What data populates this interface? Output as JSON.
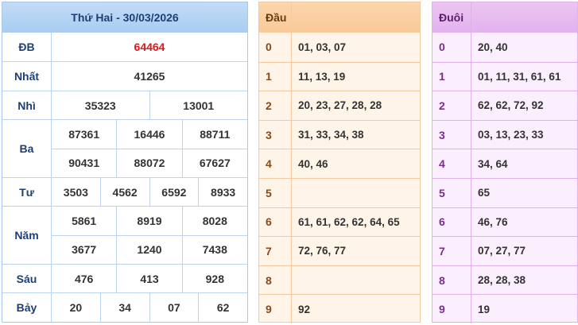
{
  "results": {
    "title": "Thứ Hai - 30/03/2026",
    "prizes": [
      {
        "name": "ĐB",
        "lines": [
          [
            "64464"
          ]
        ]
      },
      {
        "name": "Nhất",
        "lines": [
          [
            "41265"
          ]
        ]
      },
      {
        "name": "Nhì",
        "lines": [
          [
            "35323",
            "13001"
          ]
        ]
      },
      {
        "name": "Ba",
        "lines": [
          [
            "87361",
            "16446",
            "88711"
          ],
          [
            "90431",
            "88072",
            "67627"
          ]
        ]
      },
      {
        "name": "Tư",
        "lines": [
          [
            "3503",
            "4562",
            "6592",
            "8933"
          ]
        ]
      },
      {
        "name": "Năm",
        "lines": [
          [
            "5861",
            "8919",
            "8028"
          ],
          [
            "3677",
            "1240",
            "7438"
          ]
        ]
      },
      {
        "name": "Sáu",
        "lines": [
          [
            "476",
            "413",
            "928"
          ]
        ]
      },
      {
        "name": "Bảy",
        "lines": [
          [
            "20",
            "34",
            "07",
            "62"
          ]
        ]
      }
    ]
  },
  "dau": {
    "header": "Đầu",
    "rows": [
      {
        "k": "0",
        "v": "01, 03, 07"
      },
      {
        "k": "1",
        "v": "11, 13, 19"
      },
      {
        "k": "2",
        "v": "20, 23, 27, 28, 28"
      },
      {
        "k": "3",
        "v": "31, 33, 34, 38"
      },
      {
        "k": "4",
        "v": "40, 46"
      },
      {
        "k": "5",
        "v": ""
      },
      {
        "k": "6",
        "v": "61, 61, 62, 62, 64, 65"
      },
      {
        "k": "7",
        "v": "72, 76, 77"
      },
      {
        "k": "8",
        "v": ""
      },
      {
        "k": "9",
        "v": "92"
      }
    ]
  },
  "duoi": {
    "header": "Đuôi",
    "rows": [
      {
        "k": "0",
        "v": "20, 40"
      },
      {
        "k": "1",
        "v": "01, 11, 31, 61, 61"
      },
      {
        "k": "2",
        "v": "62, 62, 72, 92"
      },
      {
        "k": "3",
        "v": "03, 13, 23, 33"
      },
      {
        "k": "4",
        "v": "34, 64"
      },
      {
        "k": "5",
        "v": "65"
      },
      {
        "k": "6",
        "v": "46, 76"
      },
      {
        "k": "7",
        "v": "07, 27, 77"
      },
      {
        "k": "8",
        "v": "28, 28, 38"
      },
      {
        "k": "9",
        "v": "19"
      }
    ]
  }
}
